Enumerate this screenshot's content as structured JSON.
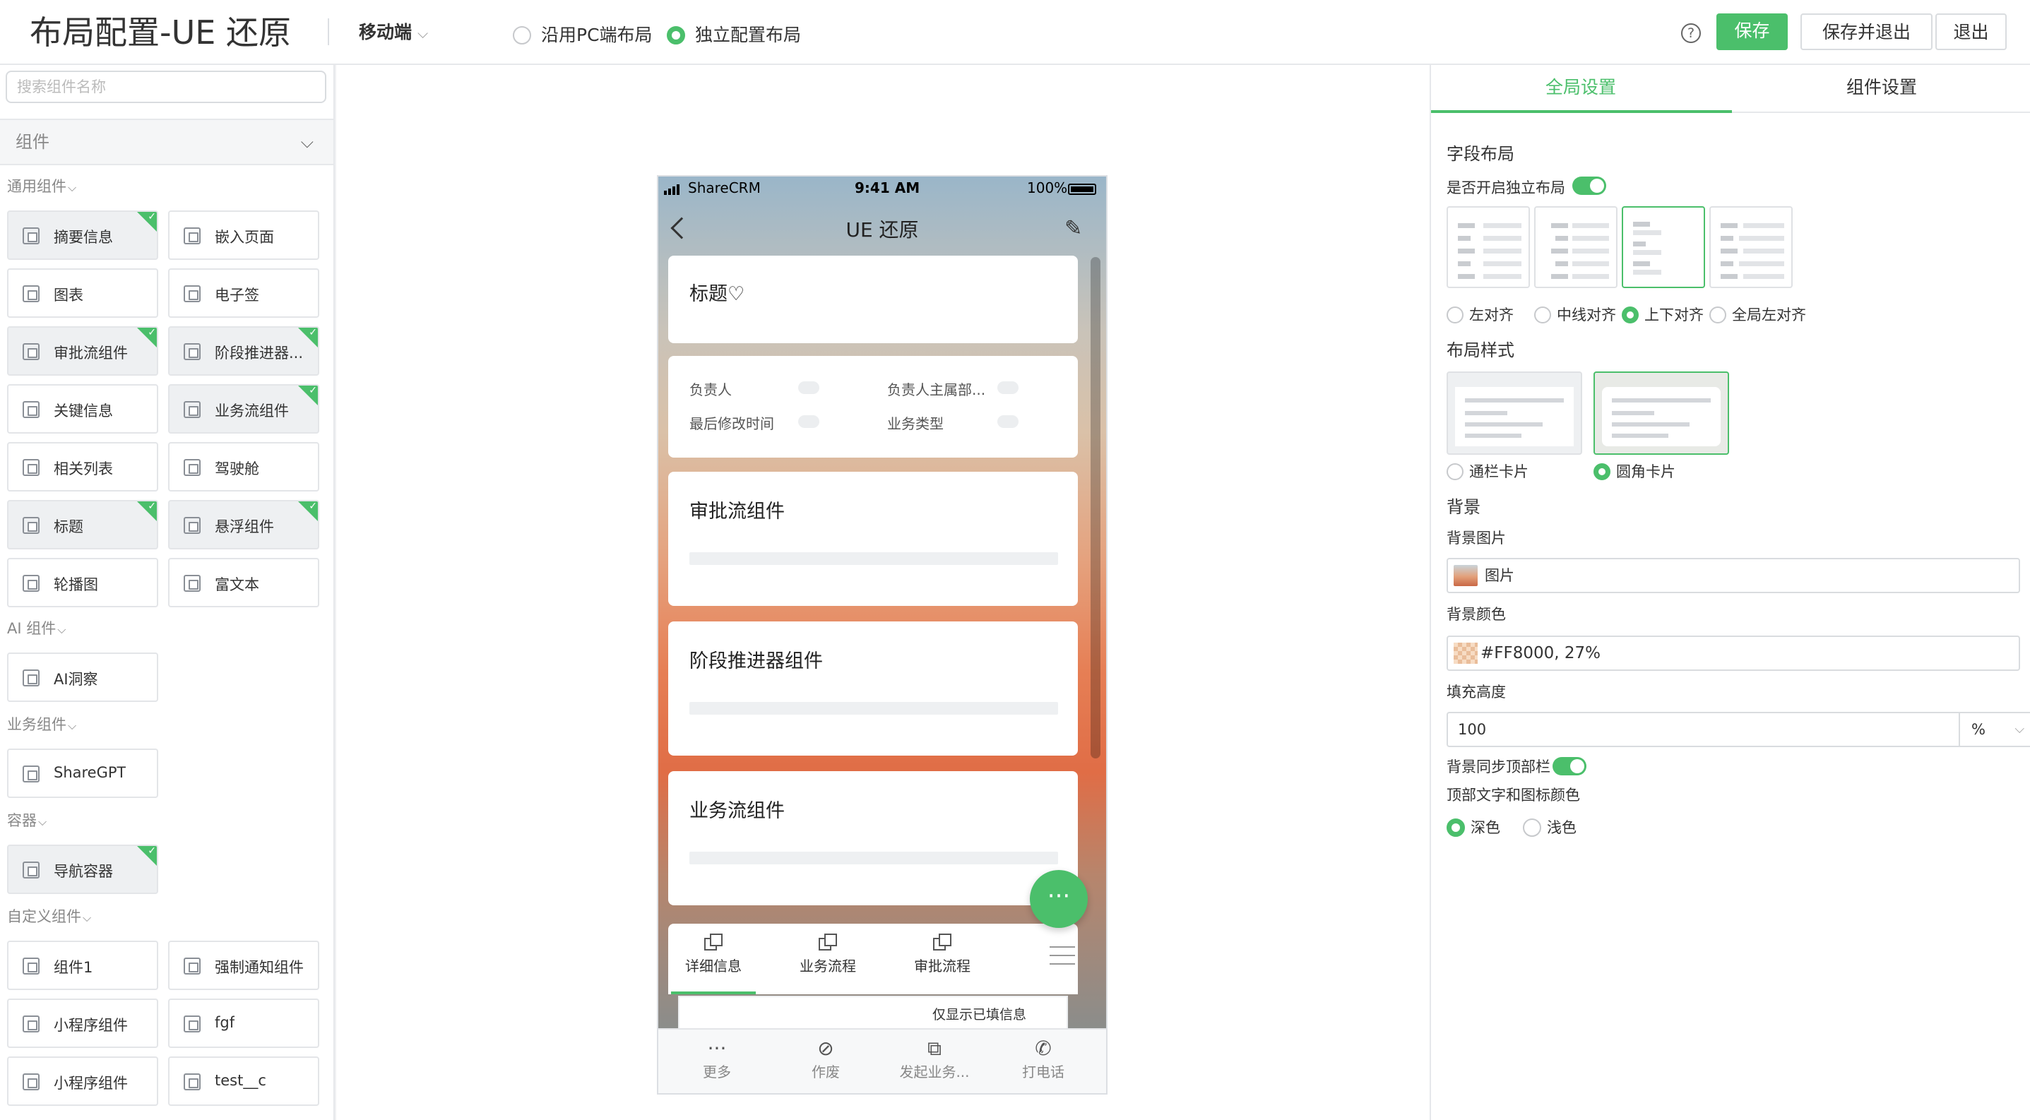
{
  "header": {
    "title": "布局配置-UE 还原",
    "platform": "移动端",
    "layout_options": [
      "沿用PC端布局",
      "独立配置布局"
    ],
    "selected_layout_option": 1,
    "buttons": {
      "help": "?",
      "save": "保存",
      "save_exit": "保存并退出",
      "exit": "退出"
    }
  },
  "left_panel": {
    "search_placeholder": "搜索组件名称",
    "category": "组件",
    "groups": [
      {
        "title": "通用组件",
        "items": [
          {
            "label": "摘要信息",
            "added": true
          },
          {
            "label": "嵌入页面",
            "added": false
          },
          {
            "label": "图表",
            "added": false
          },
          {
            "label": "电子签",
            "added": false
          },
          {
            "label": "审批流组件",
            "added": true
          },
          {
            "label": "阶段推进器...",
            "added": true
          },
          {
            "label": "关键信息",
            "added": false
          },
          {
            "label": "业务流组件",
            "added": true
          },
          {
            "label": "相关列表",
            "added": false
          },
          {
            "label": "驾驶舱",
            "added": false
          },
          {
            "label": "标题",
            "added": true
          },
          {
            "label": "悬浮组件",
            "added": true
          },
          {
            "label": "轮播图",
            "added": false
          },
          {
            "label": "富文本",
            "added": false
          }
        ]
      },
      {
        "title": "AI 组件",
        "items": [
          {
            "label": "AI洞察",
            "added": false
          }
        ]
      },
      {
        "title": "业务组件",
        "items": [
          {
            "label": "ShareGPT",
            "added": false
          }
        ]
      },
      {
        "title": "容器",
        "items": [
          {
            "label": "导航容器",
            "added": true
          }
        ]
      },
      {
        "title": "自定义组件",
        "items": [
          {
            "label": "组件1",
            "added": false
          },
          {
            "label": "强制通知组件",
            "added": false
          },
          {
            "label": "小程序组件",
            "added": false
          },
          {
            "label": "fgf",
            "added": false
          },
          {
            "label": "小程序组件",
            "added": false
          },
          {
            "label": "test__c",
            "added": false
          }
        ]
      }
    ]
  },
  "phone": {
    "status": {
      "carrier": "ShareCRM",
      "time": "9:41 AM",
      "battery": "100%"
    },
    "nav_title": "UE 还原",
    "title_card": "标题♡",
    "summary_fields": [
      {
        "label": "负责人"
      },
      {
        "label": "负责人主属部..."
      },
      {
        "label": "最后修改时间"
      },
      {
        "label": "业务类型"
      }
    ],
    "cards": [
      "审批流组件",
      "阶段推进器组件",
      "业务流组件"
    ],
    "fab": "···",
    "tabs": [
      "详细信息",
      "业务流程",
      "审批流程"
    ],
    "active_tab": 0,
    "sub_text": "仅显示已填信息",
    "bottom_actions": [
      {
        "icon": "more-icon",
        "glyph": "···",
        "label": "更多"
      },
      {
        "icon": "void-icon",
        "glyph": "⊘",
        "label": "作废"
      },
      {
        "icon": "launch-icon",
        "glyph": "⧉",
        "label": "发起业务..."
      },
      {
        "icon": "phone-icon",
        "glyph": "✆",
        "label": "打电话"
      }
    ]
  },
  "right_panel": {
    "tabs": [
      "全局设置",
      "组件设置"
    ],
    "active_tab": 0,
    "field_layout": {
      "heading": "字段布局",
      "independent_label": "是否开启独立布局",
      "independent_on": true,
      "align_options": [
        "左对齐",
        "中线对齐",
        "上下对齐",
        "全局左对齐"
      ],
      "selected_align": 2
    },
    "layout_style": {
      "heading": "布局样式",
      "options": [
        "通栏卡片",
        "圆角卡片"
      ],
      "selected": 1
    },
    "background": {
      "heading": "背景",
      "image_label": "背景图片",
      "image_value": "图片",
      "color_label": "背景颜色",
      "color_value": "#FF8000, 27%",
      "fill_label": "填充高度",
      "fill_value": "100",
      "fill_unit": "%",
      "sync_label": "背景同步顶部栏",
      "sync_on": true,
      "top_color_label": "顶部文字和图标颜色",
      "top_color_options": [
        "深色",
        "浅色"
      ],
      "top_color_selected": 0
    }
  },
  "colors": {
    "accent": "#4bbf6b",
    "background_overlay": "#FF8000"
  }
}
